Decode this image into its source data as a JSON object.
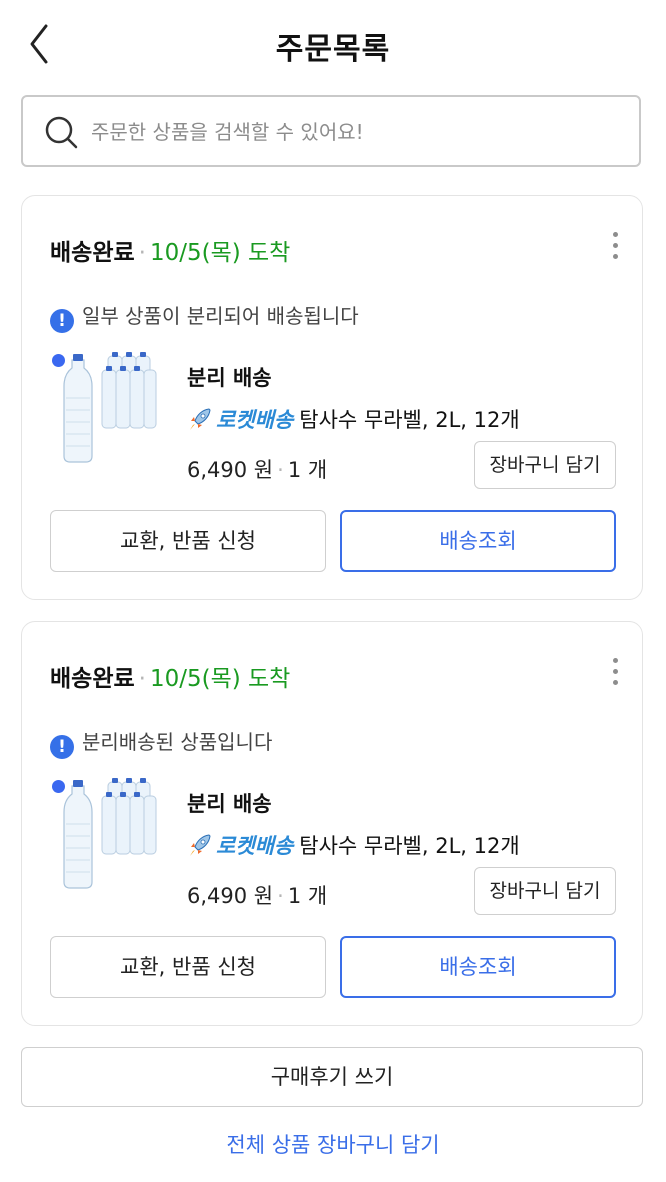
{
  "header": {
    "title": "주문목록"
  },
  "search": {
    "placeholder": "주문한 상품을 검색할 수 있어요!"
  },
  "orders": [
    {
      "status": "배송완료",
      "separator": "·",
      "arrival": "10/5(목) 도착",
      "notice": "일부 상품이 분리되어 배송됩니다",
      "delivery_type": "분리 배송",
      "badge": "로켓배송",
      "product_name": "탐사수 무라벨, 2L, 12개",
      "price": "6,490 원",
      "quantity": "1 개",
      "cart_button": "장바구니 담기",
      "return_button": "교환, 반품 신청",
      "track_button": "배송조회"
    },
    {
      "status": "배송완료",
      "separator": "·",
      "arrival": "10/5(목) 도착",
      "notice": "분리배송된 상품입니다",
      "delivery_type": "분리 배송",
      "badge": "로켓배송",
      "product_name": "탐사수 무라벨, 2L, 12개",
      "price": "6,490 원",
      "quantity": "1 개",
      "cart_button": "장바구니 담기",
      "return_button": "교환, 반품 신청",
      "track_button": "배송조회"
    }
  ],
  "footer": {
    "review_button": "구매후기 쓰기",
    "all_cart_link": "전체 상품 장바구니 담기"
  },
  "colors": {
    "accent_blue": "#3a6ee8",
    "arrival_green": "#1a9a21",
    "rocket_blue": "#2b8ad6"
  },
  "icons": [
    "back-arrow-icon",
    "search-icon",
    "more-options-icon",
    "info-icon",
    "rocket-icon"
  ]
}
